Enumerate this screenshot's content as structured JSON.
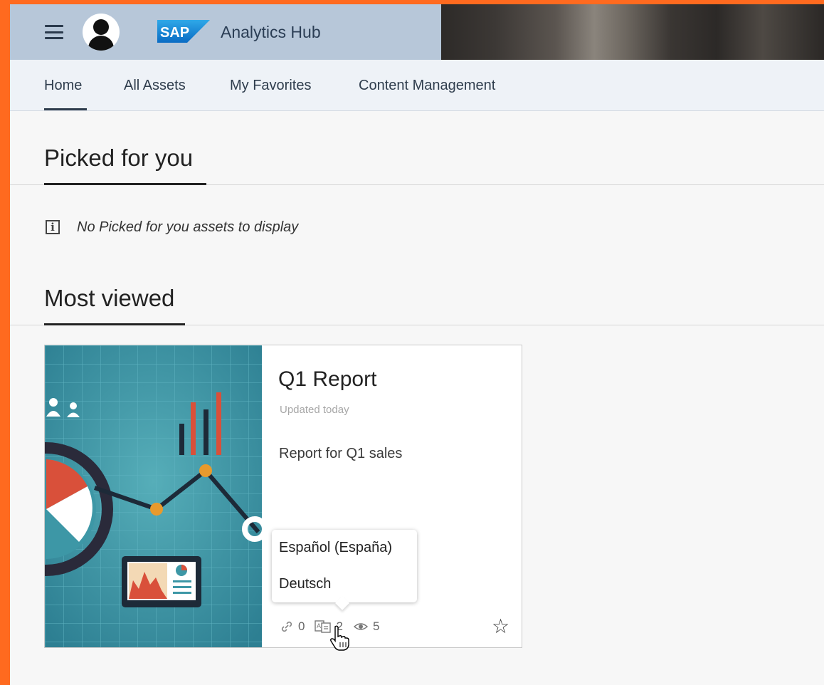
{
  "header": {
    "logo_text": "SAP",
    "app_title": "Analytics Hub"
  },
  "tabs": [
    {
      "label": "Home",
      "selected": true
    },
    {
      "label": "All Assets"
    },
    {
      "label": "My Favorites"
    },
    {
      "label": "Content Management"
    }
  ],
  "sections": {
    "picked": {
      "title": "Picked for you",
      "empty_message": "No Picked for you assets to display"
    },
    "most_viewed": {
      "title": "Most viewed"
    }
  },
  "card": {
    "title": "Q1 Report",
    "updated": "Updated today",
    "description": "Report for Q1 sales",
    "links_count": "0",
    "languages_count": "2",
    "views_count": "5"
  },
  "language_popover": {
    "items": [
      "Español (España)",
      "Deutsch"
    ]
  },
  "colors": {
    "accent_frame": "#ff6a1f",
    "shellbar": "#b7c7d9",
    "card_image_bg": "#3d97a6",
    "chart_red": "#d9503a",
    "chart_orange": "#e89a2c"
  }
}
